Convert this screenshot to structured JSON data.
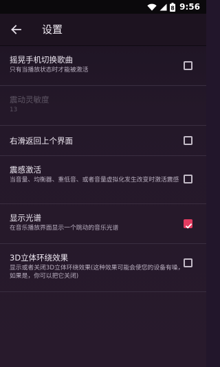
{
  "status_bar": {
    "time": "9:56",
    "battery_level": "8",
    "icons": [
      "wifi-icon",
      "signal-icon",
      "battery-icon"
    ]
  },
  "toolbar": {
    "back_icon": "arrow-left-icon",
    "title": "设置"
  },
  "settings": [
    {
      "title": "摇晃手机切换歌曲",
      "subtitle": "只有当播放状态时才能被激活",
      "checked": false,
      "enabled": true
    },
    {
      "title": "震动灵敏度",
      "subtitle": "13",
      "enabled": false
    },
    {
      "title": "右滑返回上个界面",
      "subtitle": "",
      "checked": false,
      "enabled": true
    },
    {
      "title": "震感激活",
      "subtitle": "当音量、均衡器、重低音、或者音量虚拟化发生改变时激活震感",
      "checked": false,
      "enabled": true
    },
    {
      "title": "显示光谱",
      "subtitle": "在音乐播放界面显示一个跳动的音乐光谱",
      "checked": true,
      "enabled": true
    },
    {
      "title": "3D立体环绕效果",
      "subtitle": "显示或者关闭3D立体环绕效果(这种效果可能会使您的设备有噪，如果是，你可以把它关闭)",
      "checked": false,
      "enabled": true
    }
  ],
  "colors": {
    "accent": "#e33b60",
    "background": "#241829",
    "toolbar": "#1d1320"
  }
}
